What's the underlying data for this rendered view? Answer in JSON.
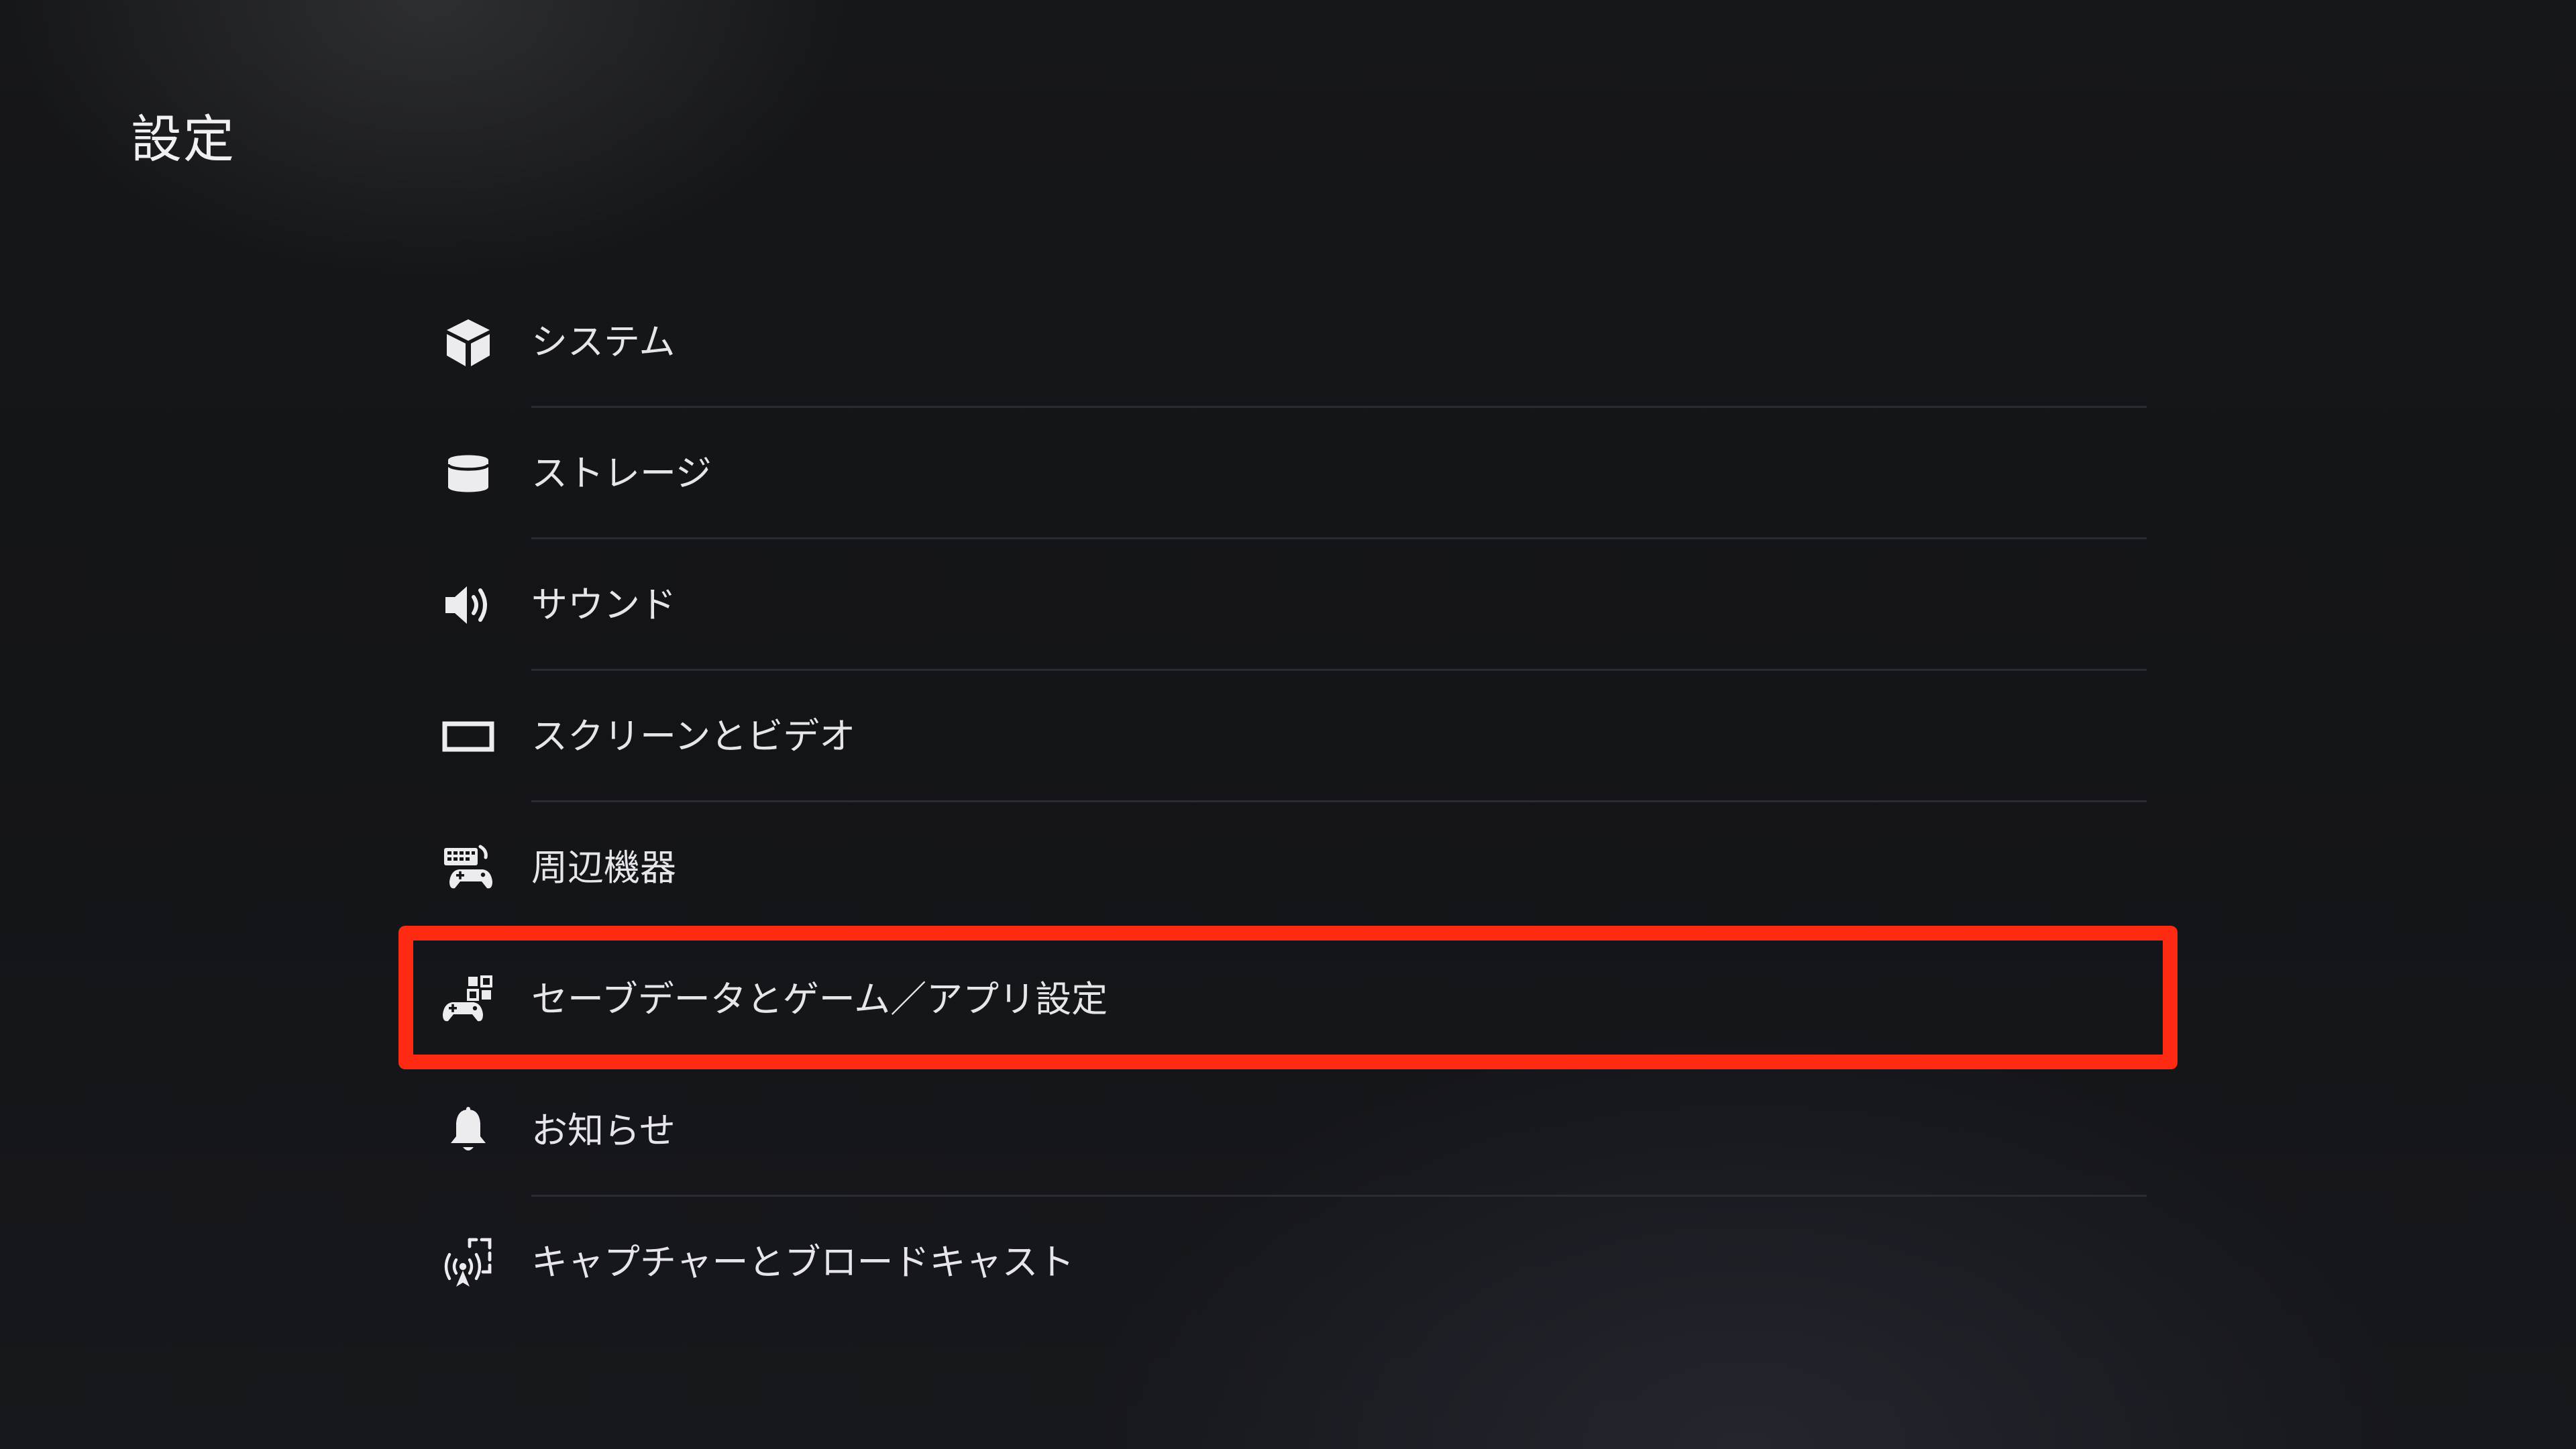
{
  "page": {
    "title": "設定"
  },
  "menu": {
    "items": [
      {
        "label": "システム",
        "icon": "cube-icon"
      },
      {
        "label": "ストレージ",
        "icon": "storage-cylinder-icon"
      },
      {
        "label": "サウンド",
        "icon": "speaker-icon"
      },
      {
        "label": "スクリーンとビデオ",
        "icon": "screen-icon"
      },
      {
        "label": "周辺機器",
        "icon": "accessories-icon"
      },
      {
        "label": "セーブデータとゲーム／アプリ設定",
        "icon": "gamepad-apps-icon"
      },
      {
        "label": "お知らせ",
        "icon": "bell-icon"
      },
      {
        "label": "キャプチャーとブロードキャスト",
        "icon": "broadcast-icon"
      }
    ]
  },
  "highlight": {
    "color": "#ff2a12",
    "target_index": 5
  },
  "colors": {
    "background": "#141519",
    "text": "#e6e6ea",
    "divider": "#2a2c31"
  }
}
